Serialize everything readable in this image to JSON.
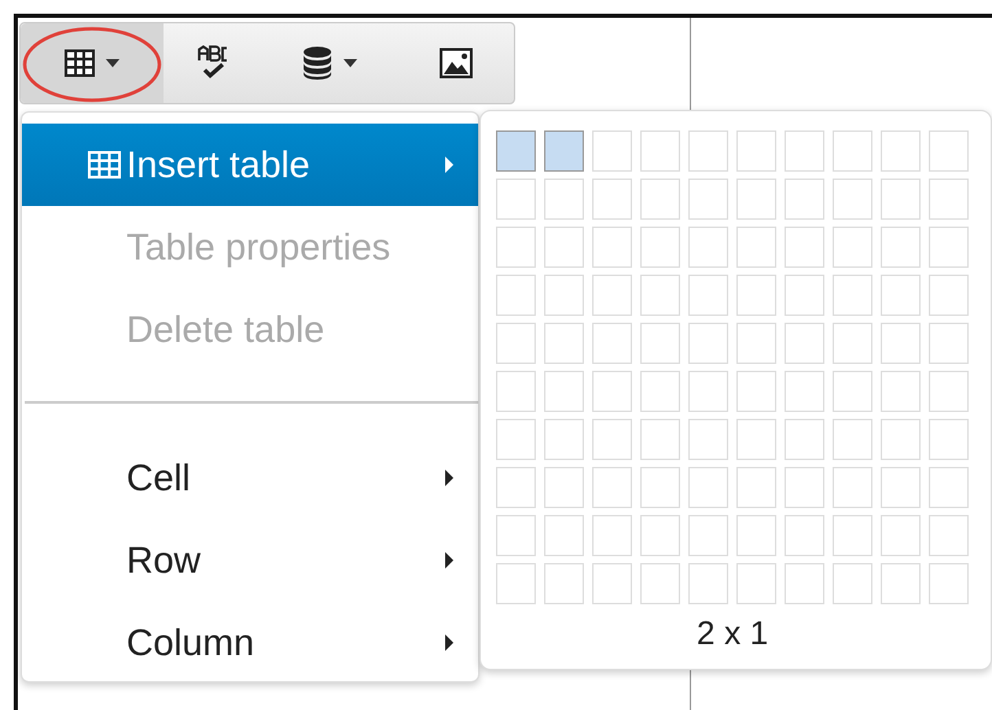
{
  "toolbar": {
    "buttons": [
      {
        "kind": "table",
        "dropdown": true,
        "selected": true,
        "circled": true
      },
      {
        "kind": "spellcheck",
        "dropdown": false,
        "selected": false,
        "circled": false
      },
      {
        "kind": "database",
        "dropdown": true,
        "selected": false,
        "circled": false
      },
      {
        "kind": "image",
        "dropdown": false,
        "selected": false,
        "circled": false
      }
    ]
  },
  "menu": {
    "items": [
      {
        "kind": "item",
        "label": "Insert table",
        "icon": true,
        "submenu": true,
        "selected": true,
        "disabled": false
      },
      {
        "kind": "item",
        "label": "Table properties",
        "icon": false,
        "submenu": false,
        "selected": false,
        "disabled": true
      },
      {
        "kind": "item",
        "label": "Delete table",
        "icon": false,
        "submenu": false,
        "selected": false,
        "disabled": true
      },
      {
        "kind": "separator"
      },
      {
        "kind": "item",
        "label": "Cell",
        "icon": false,
        "submenu": true,
        "selected": false,
        "disabled": false
      },
      {
        "kind": "item",
        "label": "Row",
        "icon": false,
        "submenu": true,
        "selected": false,
        "disabled": false
      },
      {
        "kind": "item",
        "label": "Column",
        "icon": false,
        "submenu": true,
        "selected": false,
        "disabled": false
      }
    ]
  },
  "table_picker": {
    "grid": [
      [
        {
          "selected": true
        },
        {
          "selected": true
        },
        {
          "selected": false
        },
        {
          "selected": false
        },
        {
          "selected": false
        },
        {
          "selected": false
        },
        {
          "selected": false
        },
        {
          "selected": false
        },
        {
          "selected": false
        },
        {
          "selected": false
        }
      ],
      [
        {
          "selected": false
        },
        {
          "selected": false
        },
        {
          "selected": false
        },
        {
          "selected": false
        },
        {
          "selected": false
        },
        {
          "selected": false
        },
        {
          "selected": false
        },
        {
          "selected": false
        },
        {
          "selected": false
        },
        {
          "selected": false
        }
      ],
      [
        {
          "selected": false
        },
        {
          "selected": false
        },
        {
          "selected": false
        },
        {
          "selected": false
        },
        {
          "selected": false
        },
        {
          "selected": false
        },
        {
          "selected": false
        },
        {
          "selected": false
        },
        {
          "selected": false
        },
        {
          "selected": false
        }
      ],
      [
        {
          "selected": false
        },
        {
          "selected": false
        },
        {
          "selected": false
        },
        {
          "selected": false
        },
        {
          "selected": false
        },
        {
          "selected": false
        },
        {
          "selected": false
        },
        {
          "selected": false
        },
        {
          "selected": false
        },
        {
          "selected": false
        }
      ],
      [
        {
          "selected": false
        },
        {
          "selected": false
        },
        {
          "selected": false
        },
        {
          "selected": false
        },
        {
          "selected": false
        },
        {
          "selected": false
        },
        {
          "selected": false
        },
        {
          "selected": false
        },
        {
          "selected": false
        },
        {
          "selected": false
        }
      ],
      [
        {
          "selected": false
        },
        {
          "selected": false
        },
        {
          "selected": false
        },
        {
          "selected": false
        },
        {
          "selected": false
        },
        {
          "selected": false
        },
        {
          "selected": false
        },
        {
          "selected": false
        },
        {
          "selected": false
        },
        {
          "selected": false
        }
      ],
      [
        {
          "selected": false
        },
        {
          "selected": false
        },
        {
          "selected": false
        },
        {
          "selected": false
        },
        {
          "selected": false
        },
        {
          "selected": false
        },
        {
          "selected": false
        },
        {
          "selected": false
        },
        {
          "selected": false
        },
        {
          "selected": false
        }
      ],
      [
        {
          "selected": false
        },
        {
          "selected": false
        },
        {
          "selected": false
        },
        {
          "selected": false
        },
        {
          "selected": false
        },
        {
          "selected": false
        },
        {
          "selected": false
        },
        {
          "selected": false
        },
        {
          "selected": false
        },
        {
          "selected": false
        }
      ],
      [
        {
          "selected": false
        },
        {
          "selected": false
        },
        {
          "selected": false
        },
        {
          "selected": false
        },
        {
          "selected": false
        },
        {
          "selected": false
        },
        {
          "selected": false
        },
        {
          "selected": false
        },
        {
          "selected": false
        },
        {
          "selected": false
        }
      ],
      [
        {
          "selected": false
        },
        {
          "selected": false
        },
        {
          "selected": false
        },
        {
          "selected": false
        },
        {
          "selected": false
        },
        {
          "selected": false
        },
        {
          "selected": false
        },
        {
          "selected": false
        },
        {
          "selected": false
        },
        {
          "selected": false
        }
      ]
    ],
    "size_label": "2 x 1"
  }
}
